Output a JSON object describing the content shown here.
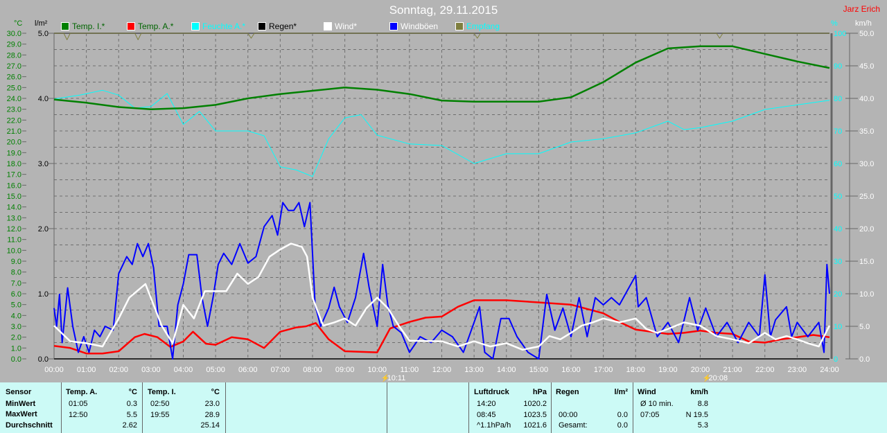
{
  "title": "Sonntag, 29.11.2015",
  "author": "Jarz Erich",
  "legend": [
    {
      "label": "Temp. I.*",
      "color": "#008000",
      "text": "#006400"
    },
    {
      "label": "Temp. A.*",
      "color": "#ff0000",
      "text": "#006400"
    },
    {
      "label": "Feuchte A.*",
      "color": "#00ffff",
      "text": "#00ffff"
    },
    {
      "label": "Regen*",
      "color": "#000000",
      "text": "#000000"
    },
    {
      "label": "Wind*",
      "color": "#ffffff",
      "text": "#ffffff"
    },
    {
      "label": "Windböen",
      "color": "#0000ff",
      "text": "#ffffff"
    },
    {
      "label": "Empfang",
      "color": "#7f7f3f",
      "text": "#00ffff"
    }
  ],
  "units": {
    "temp": "°C",
    "rain": "l/m²",
    "humidity": "%",
    "wind": "km/h"
  },
  "events": [
    {
      "label": "10:11",
      "hour": 10.18
    },
    {
      "label": "20:08",
      "hour": 20.13
    }
  ],
  "chart_data": {
    "type": "line",
    "title": "Sonntag, 29.11.2015",
    "xlabel": "",
    "x_ticks": [
      "00:00",
      "01:00",
      "02:00",
      "03:00",
      "04:00",
      "05:00",
      "06:00",
      "07:00",
      "08:00",
      "09:00",
      "10:00",
      "11:00",
      "12:00",
      "13:00",
      "14:00",
      "15:00",
      "16:00",
      "17:00",
      "18:00",
      "19:00",
      "20:00",
      "21:00",
      "22:00",
      "23:00",
      "24:00"
    ],
    "xlim": [
      0,
      24
    ],
    "axes": {
      "temp": {
        "label": "°C",
        "range": [
          0,
          30
        ],
        "ticks": [
          "0.0",
          "1.0",
          "2.0",
          "3.0",
          "4.0",
          "5.0",
          "6.0",
          "7.0",
          "8.0",
          "9.0",
          "10.0",
          "11.0",
          "12.0",
          "13.0",
          "14.0",
          "15.0",
          "16.0",
          "17.0",
          "18.0",
          "19.0",
          "20.0",
          "21.0",
          "22.0",
          "23.0",
          "24.0",
          "25.0",
          "26.0",
          "27.0",
          "28.0",
          "29.0",
          "30.0"
        ]
      },
      "rain": {
        "label": "l/m²",
        "range": [
          0,
          5
        ],
        "ticks": [
          "0.0",
          "1.0",
          "2.0",
          "3.0",
          "4.0",
          "5.0"
        ]
      },
      "humidity": {
        "label": "%",
        "range": [
          0,
          100
        ],
        "ticks": [
          "0",
          "10",
          "20",
          "30",
          "40",
          "50",
          "60",
          "70",
          "80",
          "90",
          "100"
        ]
      },
      "wind": {
        "label": "km/h",
        "range": [
          0,
          50
        ],
        "ticks": [
          "0.0",
          "5.0",
          "10.0",
          "15.0",
          "20.0",
          "25.0",
          "30.0",
          "35.0",
          "40.0",
          "45.0",
          "50.0"
        ]
      }
    },
    "series": [
      {
        "name": "Temp. I.*",
        "axis": "temp",
        "color": "#008000",
        "width": 2.5,
        "x": [
          0,
          1,
          2,
          3,
          4,
          5,
          6,
          7,
          8,
          9,
          10,
          11,
          12,
          13,
          14,
          15,
          16,
          17,
          18,
          19,
          20,
          21,
          22,
          23,
          24
        ],
        "y": [
          23.9,
          23.6,
          23.2,
          23.0,
          23.1,
          23.4,
          24.0,
          24.4,
          24.7,
          25.0,
          24.8,
          24.4,
          23.8,
          23.7,
          23.7,
          23.7,
          24.1,
          25.5,
          27.3,
          28.6,
          28.8,
          28.8,
          28.1,
          27.4,
          26.8
        ]
      },
      {
        "name": "Temp. A.*",
        "axis": "temp",
        "color": "#ff0000",
        "width": 2.5,
        "x": [
          0,
          0.5,
          1,
          1.5,
          2,
          2.5,
          2.8,
          3.2,
          3.6,
          4,
          4.3,
          4.7,
          5,
          5.5,
          6,
          6.5,
          7,
          7.5,
          7.8,
          8.1,
          8.5,
          9,
          10,
          10.4,
          11,
          11.5,
          12,
          12.5,
          13,
          14,
          15,
          16,
          16.5,
          17,
          17.5,
          18,
          19,
          19.5,
          20,
          20.5,
          21,
          21.5,
          22,
          22.5,
          23,
          23.5,
          24
        ],
        "y": [
          1.2,
          1.0,
          0.5,
          0.5,
          0.7,
          2.0,
          2.3,
          2.0,
          1.1,
          1.6,
          2.5,
          1.4,
          1.3,
          2.0,
          1.8,
          1.0,
          2.5,
          2.9,
          3.0,
          3.3,
          1.8,
          0.7,
          0.6,
          2.8,
          3.4,
          3.8,
          3.9,
          4.8,
          5.4,
          5.4,
          5.2,
          5.0,
          4.6,
          4.2,
          3.4,
          2.7,
          2.3,
          2.4,
          2.6,
          2.4,
          2.3,
          1.6,
          1.5,
          1.8,
          2.0,
          2.2,
          2.0
        ]
      },
      {
        "name": "Feuchte A.*",
        "axis": "humidity",
        "color": "#00ffff",
        "width": 1,
        "x": [
          0,
          0.8,
          1.5,
          2.0,
          2.5,
          3.0,
          3.5,
          4.0,
          4.5,
          5.0,
          5.5,
          6.0,
          6.5,
          7.0,
          7.5,
          8.0,
          8.5,
          9.0,
          9.5,
          10.0,
          11.0,
          12.0,
          13.0,
          14.0,
          15.0,
          16.0,
          17.0,
          18.0,
          19.0,
          19.5,
          20.0,
          21.0,
          22.0,
          23.0,
          24.0
        ],
        "y": [
          79.8,
          81,
          82.5,
          81,
          77,
          77.5,
          81.5,
          72,
          76,
          70,
          70,
          70,
          68.5,
          59,
          58,
          56,
          67.6,
          74,
          75,
          68.7,
          66,
          65.5,
          60,
          63,
          63,
          66.6,
          67.6,
          69.4,
          73,
          70.4,
          71,
          73,
          76.6,
          78,
          79.4
        ]
      },
      {
        "name": "Regen*",
        "axis": "rain",
        "color": "#000000",
        "width": 1,
        "x": [
          0,
          24
        ],
        "y": [
          0,
          0
        ]
      },
      {
        "name": "Windböen",
        "axis": "wind",
        "color": "#0000ff",
        "width": 2,
        "x": [
          0,
          0.08,
          0.17,
          0.25,
          0.42,
          0.58,
          0.75,
          0.92,
          1.08,
          1.25,
          1.42,
          1.58,
          1.83,
          2.0,
          2.25,
          2.42,
          2.58,
          2.75,
          2.92,
          3.08,
          3.25,
          3.5,
          3.67,
          3.83,
          4.0,
          4.17,
          4.42,
          4.58,
          4.75,
          4.92,
          5.08,
          5.25,
          5.5,
          5.75,
          6.0,
          6.25,
          6.5,
          6.75,
          6.92,
          7.08,
          7.25,
          7.42,
          7.58,
          7.75,
          7.92,
          8.08,
          8.25,
          8.5,
          8.67,
          8.83,
          9.08,
          9.33,
          9.58,
          9.75,
          10.0,
          10.17,
          10.33,
          10.5,
          10.75,
          11.0,
          11.33,
          11.67,
          12.0,
          12.33,
          12.67,
          13.0,
          13.17,
          13.33,
          13.58,
          13.83,
          14.08,
          14.33,
          14.67,
          15.0,
          15.25,
          15.5,
          15.75,
          16.0,
          16.25,
          16.5,
          16.75,
          17.0,
          17.25,
          17.5,
          18.0,
          18.08,
          18.33,
          18.67,
          19.0,
          19.33,
          19.67,
          19.92,
          20.17,
          20.5,
          20.83,
          21.17,
          21.5,
          21.83,
          22.0,
          22.17,
          22.33,
          22.67,
          22.83,
          23.0,
          23.33,
          23.67,
          23.83,
          23.92,
          24.0
        ],
        "y": [
          7.8,
          5.0,
          9.9,
          2.5,
          10.9,
          5.0,
          1.0,
          3.4,
          1.0,
          4.4,
          3.4,
          5.0,
          4.4,
          13.1,
          15.7,
          14.5,
          17.7,
          15.7,
          17.7,
          14.0,
          5.0,
          5.0,
          0,
          8.3,
          11.5,
          16.0,
          16.0,
          9.4,
          5.0,
          9.4,
          14.5,
          16.2,
          14.5,
          17.7,
          14.7,
          15.7,
          20.3,
          22.0,
          19.0,
          24.0,
          22.8,
          22.8,
          24.0,
          20.3,
          24.0,
          8.3,
          5.0,
          7.8,
          11.0,
          8.0,
          5.6,
          9.4,
          16.2,
          11.0,
          5.0,
          14.5,
          8.3,
          5.0,
          4.0,
          1.0,
          3.4,
          2.5,
          4.4,
          3.4,
          1.0,
          5.6,
          8.0,
          1.0,
          0,
          6.2,
          6.2,
          3.4,
          1.0,
          0,
          9.9,
          4.4,
          7.8,
          3.4,
          9.4,
          3.4,
          9.4,
          8.3,
          9.4,
          8.3,
          12.8,
          8.0,
          9.4,
          3.4,
          5.6,
          2.5,
          9.4,
          4.4,
          7.8,
          3.4,
          5.6,
          2.5,
          5.6,
          3.4,
          12.9,
          3.4,
          6.0,
          8.0,
          3.4,
          5.6,
          3.4,
          5.6,
          1.0,
          14.5,
          10.0
        ]
      },
      {
        "name": "Wind*",
        "axis": "wind",
        "color": "#ffffff",
        "width": 2.5,
        "x": [
          0,
          0.5,
          1,
          1.5,
          2,
          2.33,
          2.83,
          3.33,
          3.67,
          4,
          4.33,
          4.67,
          5.33,
          5.67,
          6,
          6.33,
          6.67,
          7,
          7.33,
          7.67,
          7.83,
          8,
          8.33,
          8.67,
          9,
          9.33,
          9.67,
          10,
          10.33,
          10.67,
          11,
          12,
          12.5,
          13,
          13.5,
          14,
          14.5,
          15,
          15.33,
          15.67,
          16,
          16.33,
          16.67,
          17,
          17.5,
          18,
          18.33,
          18.67,
          19,
          19.5,
          20,
          20.5,
          21,
          21.5,
          22,
          22.33,
          22.67,
          23,
          23.33,
          23.67,
          24
        ],
        "y": [
          5.1,
          2.7,
          2.4,
          1.9,
          6.2,
          9.4,
          11.5,
          5.1,
          2.4,
          8.3,
          6.2,
          10.4,
          10.4,
          13.1,
          11.5,
          12.6,
          15.7,
          16.8,
          17.7,
          17.2,
          15.7,
          9.4,
          5.1,
          5.6,
          6.2,
          5.1,
          7.8,
          9.4,
          7.8,
          5.1,
          2.8,
          2.7,
          1.9,
          2.7,
          1.9,
          2.4,
          1.4,
          1.9,
          3.5,
          3.0,
          4.0,
          5.1,
          5.6,
          6.2,
          5.6,
          6.2,
          4.6,
          4.0,
          4.6,
          5.6,
          5.1,
          3.5,
          3.0,
          2.4,
          4.0,
          3.0,
          3.5,
          3.0,
          2.4,
          1.9,
          5.1
        ]
      },
      {
        "name": "Empfang",
        "axis": "humidity",
        "color": "#7f7f3f",
        "width": 1,
        "x": [
          0,
          0.3,
          0.4,
          0.5,
          1,
          2.5,
          2.6,
          2.7,
          6,
          6.1,
          6.2,
          13,
          13.1,
          13.2,
          20.5,
          20.6,
          20.7,
          24
        ],
        "y": [
          100,
          100,
          98,
          100,
          100,
          100,
          98,
          100,
          100,
          98.5,
          100,
          100,
          98.5,
          100,
          100,
          98.5,
          100,
          100
        ]
      }
    ]
  },
  "table": {
    "sensor": {
      "header": "Sensor",
      "rows": [
        "MinWert",
        "MaxWert",
        "Durchschnitt"
      ]
    },
    "temp_a": {
      "header": "Temp. A.",
      "unit": "°C",
      "rows": [
        [
          "01:05",
          "0.3"
        ],
        [
          "12:50",
          "5.5"
        ],
        [
          "",
          "2.62"
        ]
      ]
    },
    "temp_i": {
      "header": "Temp. I.",
      "unit": "°C",
      "rows": [
        [
          "02:50",
          "23.0"
        ],
        [
          "19:55",
          "28.9"
        ],
        [
          "",
          "25.14"
        ]
      ]
    },
    "pressure": {
      "header": "Luftdruck",
      "unit": "hPa",
      "rows": [
        [
          "14:20",
          "1020.2"
        ],
        [
          "08:45",
          "1023.5"
        ],
        [
          "^1.1hPa/h",
          "1021.6"
        ]
      ]
    },
    "rain": {
      "header": "Regen",
      "unit": "l/m²",
      "rows": [
        [
          "",
          ""
        ],
        [
          "00:00",
          "0.0"
        ],
        [
          "Gesamt:",
          "0.0"
        ]
      ]
    },
    "wind": {
      "header": "Wind",
      "unit": "km/h",
      "rows": [
        [
          "Ø 10 min.",
          "8.8"
        ],
        [
          "07:05",
          "N 19.5"
        ],
        [
          "",
          "5.3"
        ]
      ]
    }
  }
}
